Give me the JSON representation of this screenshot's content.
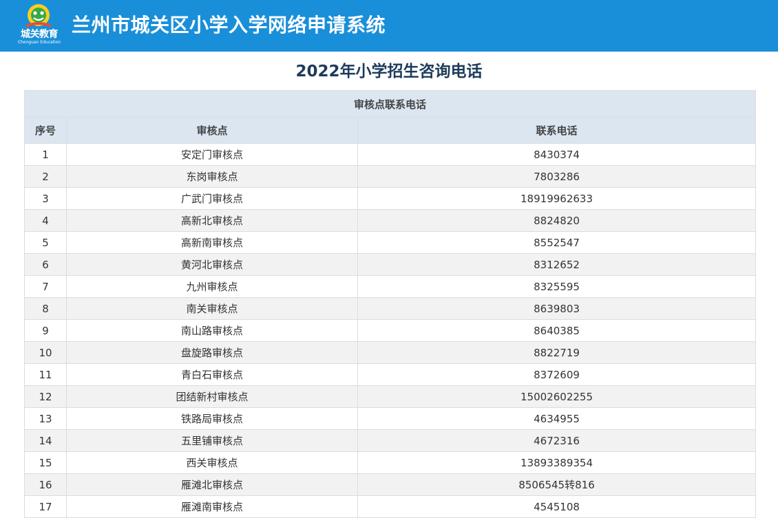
{
  "header": {
    "site_title": "兰州市城关区小学入学网络申请系统",
    "logo_text": "城关教育",
    "logo_sub": "Chenguan Education",
    "bg_color": "#1a8fd9"
  },
  "page_title": "2022年小学招生咨询电话",
  "table": {
    "caption": "审核点联系电话",
    "columns": [
      "序号",
      "审核点",
      "联系电话"
    ],
    "rows": [
      {
        "no": "1",
        "site": "安定门审核点",
        "phone": "8430374"
      },
      {
        "no": "2",
        "site": "东岗审核点",
        "phone": "7803286"
      },
      {
        "no": "3",
        "site": "广武门审核点",
        "phone": "18919962633"
      },
      {
        "no": "4",
        "site": "高新北审核点",
        "phone": "8824820"
      },
      {
        "no": "5",
        "site": "高新南审核点",
        "phone": "8552547"
      },
      {
        "no": "6",
        "site": "黄河北审核点",
        "phone": "8312652"
      },
      {
        "no": "7",
        "site": "九州审核点",
        "phone": "8325595"
      },
      {
        "no": "8",
        "site": "南关审核点",
        "phone": "8639803"
      },
      {
        "no": "9",
        "site": "南山路审核点",
        "phone": "8640385"
      },
      {
        "no": "10",
        "site": "盘旋路审核点",
        "phone": "8822719"
      },
      {
        "no": "11",
        "site": "青白石审核点",
        "phone": "8372609"
      },
      {
        "no": "12",
        "site": "团结新村审核点",
        "phone": "15002602255"
      },
      {
        "no": "13",
        "site": "铁路局审核点",
        "phone": "4634955"
      },
      {
        "no": "14",
        "site": "五里铺审核点",
        "phone": "4672316"
      },
      {
        "no": "15",
        "site": "西关审核点",
        "phone": "13893389354"
      },
      {
        "no": "16",
        "site": "雁滩北审核点",
        "phone": "8506545转816"
      },
      {
        "no": "17",
        "site": "雁滩南审核点",
        "phone": "4545108"
      }
    ]
  }
}
